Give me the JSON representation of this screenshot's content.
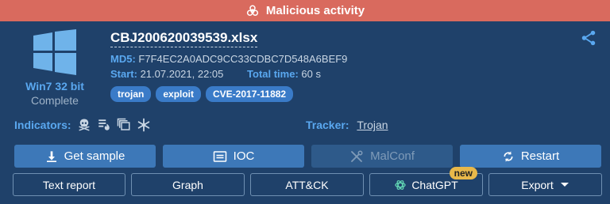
{
  "banner": {
    "text": "Malicious activity",
    "color": "#d96a5e",
    "icon": "biohazard-icon"
  },
  "os": {
    "name": "Win7 32 bit",
    "status": "Complete",
    "icon": "windows-logo-icon"
  },
  "file": {
    "name": "CBJ200620039539.xlsx"
  },
  "md5": {
    "label": "MD5:",
    "value": "F7F4EC2A0ADC9CC33CDBC7D548A6BEF9"
  },
  "start": {
    "label": "Start:",
    "value": "21.07.2021, 22:05"
  },
  "total_time": {
    "label": "Total time:",
    "value": "60 s"
  },
  "tags": [
    "trojan",
    "exploit",
    "CVE-2017-11882"
  ],
  "indicators": {
    "label": "Indicators:",
    "icons": [
      "skull-icon",
      "document-fire-icon",
      "windows-stack-icon",
      "network-asterisk-icon"
    ]
  },
  "tracker": {
    "label": "Tracker:",
    "link": "Trojan"
  },
  "actions": {
    "get_sample": "Get sample",
    "ioc": "IOC",
    "malconf": "MalConf",
    "restart": "Restart"
  },
  "secondary": {
    "text_report": "Text report",
    "graph": "Graph",
    "attck": "ATT&CK",
    "chatgpt": "ChatGPT",
    "chatgpt_badge": "new",
    "export": "Export"
  },
  "colors": {
    "accent": "#5aa8f0",
    "panel": "#1f416a",
    "button": "#3d78b8",
    "badge": "#e8b84a"
  }
}
